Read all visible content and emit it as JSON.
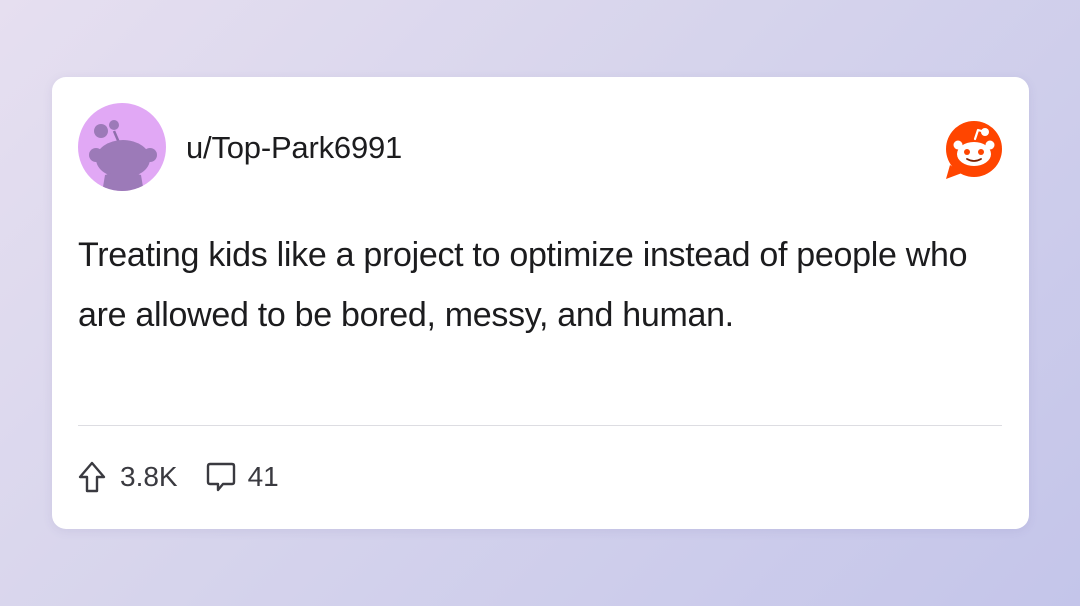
{
  "post": {
    "username": "u/Top-Park6991",
    "text": "Treating kids like a project to optimize instead of people who are allowed to be bored, messy, and human.",
    "upvotes": "3.8K",
    "comments": "41"
  },
  "icons": {
    "avatar": "snoo-avatar",
    "brand": "reddit-logo-icon",
    "upvote": "upvote-arrow-icon",
    "comment": "comment-bubble-icon"
  },
  "colors": {
    "avatar_bg": "#e1a8f5",
    "snoo": "#9c7ab8",
    "brand": "#ff4500",
    "text": "#1c1c1e"
  }
}
